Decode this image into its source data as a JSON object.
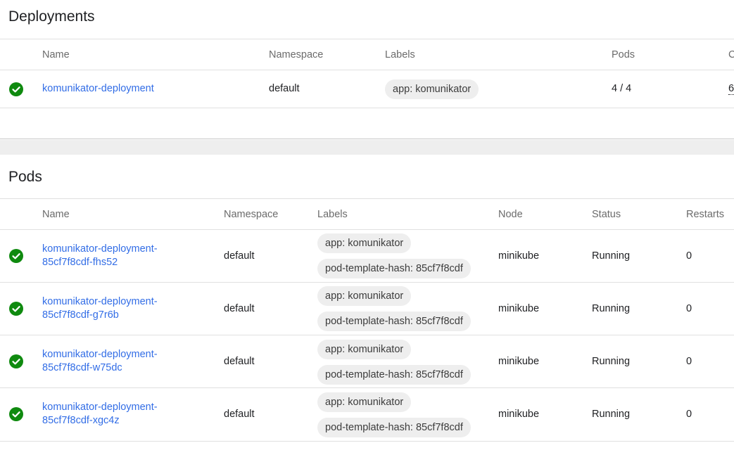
{
  "colors": {
    "success": "#0f8a0f",
    "link": "#326de6",
    "chip_bg": "#eeeeee"
  },
  "deployments": {
    "title": "Deployments",
    "columns": {
      "name": "Name",
      "namespace": "Namespace",
      "labels": "Labels",
      "pods": "Pods",
      "cut_col": "C"
    },
    "rows": [
      {
        "status_icon": "check-circle-icon",
        "name": "komunikator-deployment",
        "namespace": "default",
        "label": "app: komunikator",
        "pods": "4 / 4",
        "cut": "6"
      }
    ]
  },
  "pods": {
    "title": "Pods",
    "columns": {
      "name": "Name",
      "namespace": "Namespace",
      "labels": "Labels",
      "node": "Node",
      "status": "Status",
      "restarts": "Restarts"
    },
    "rows": [
      {
        "status_icon": "check-circle-icon",
        "name_line1": "komunikator-deployment-",
        "name_line2": "85cf7f8cdf-fhs52",
        "namespace": "default",
        "label1": "app: komunikator",
        "label2": "pod-template-hash: 85cf7f8cdf",
        "node": "minikube",
        "status": "Running",
        "restarts": "0"
      },
      {
        "status_icon": "check-circle-icon",
        "name_line1": "komunikator-deployment-",
        "name_line2": "85cf7f8cdf-g7r6b",
        "namespace": "default",
        "label1": "app: komunikator",
        "label2": "pod-template-hash: 85cf7f8cdf",
        "node": "minikube",
        "status": "Running",
        "restarts": "0"
      },
      {
        "status_icon": "check-circle-icon",
        "name_line1": "komunikator-deployment-",
        "name_line2": "85cf7f8cdf-w75dc",
        "namespace": "default",
        "label1": "app: komunikator",
        "label2": "pod-template-hash: 85cf7f8cdf",
        "node": "minikube",
        "status": "Running",
        "restarts": "0"
      },
      {
        "status_icon": "check-circle-icon",
        "name_line1": "komunikator-deployment-",
        "name_line2": "85cf7f8cdf-xgc4z",
        "namespace": "default",
        "label1": "app: komunikator",
        "label2": "pod-template-hash: 85cf7f8cdf",
        "node": "minikube",
        "status": "Running",
        "restarts": "0"
      }
    ]
  }
}
